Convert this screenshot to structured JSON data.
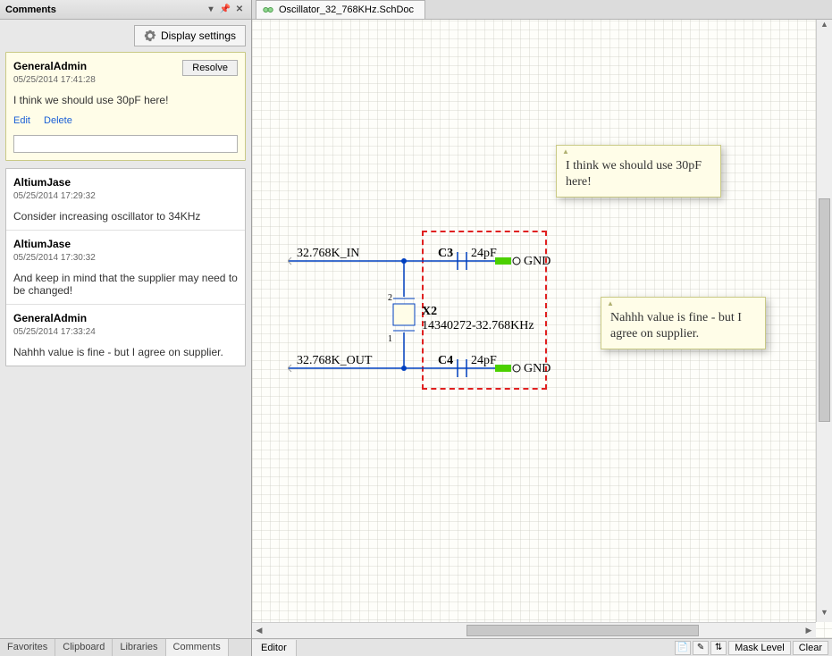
{
  "panel": {
    "title": "Comments",
    "display_settings": "Display settings"
  },
  "active_comment": {
    "user": "GeneralAdmin",
    "timestamp": "05/25/2014 17:41:28",
    "text": "I think we should use 30pF here!",
    "edit": "Edit",
    "delete": "Delete",
    "resolve": "Resolve"
  },
  "replies": [
    {
      "user": "AltiumJase",
      "timestamp": "05/25/2014 17:29:32",
      "text": "Consider increasing oscillator to 34KHz"
    },
    {
      "user": "AltiumJase",
      "timestamp": "05/25/2014 17:30:32",
      "text": "And keep in mind that the supplier may need to be changed!"
    },
    {
      "user": "GeneralAdmin",
      "timestamp": "05/25/2014 17:33:24",
      "text": "Nahhh value is fine - but I agree on supplier."
    }
  ],
  "tabs": {
    "bottom": [
      "Favorites",
      "Clipboard",
      "Libraries",
      "Comments"
    ],
    "active_bottom": "Comments"
  },
  "doc": {
    "name": "Oscillator_32_768KHz.SchDoc"
  },
  "schematic": {
    "net_in": "32.768K_IN",
    "net_out": "32.768K_OUT",
    "c3": "C3",
    "c3v": "24pF",
    "c4": "C4",
    "c4v": "24pF",
    "x2": "X2",
    "x2v": "14340272-32.768KHz",
    "gnd": "GND"
  },
  "notes": {
    "n1": "I think we should use 30pF here!",
    "n2": "Nahhh value is fine - but I agree on supplier."
  },
  "status": {
    "editor": "Editor",
    "mask": "Mask Level",
    "clear": "Clear"
  }
}
